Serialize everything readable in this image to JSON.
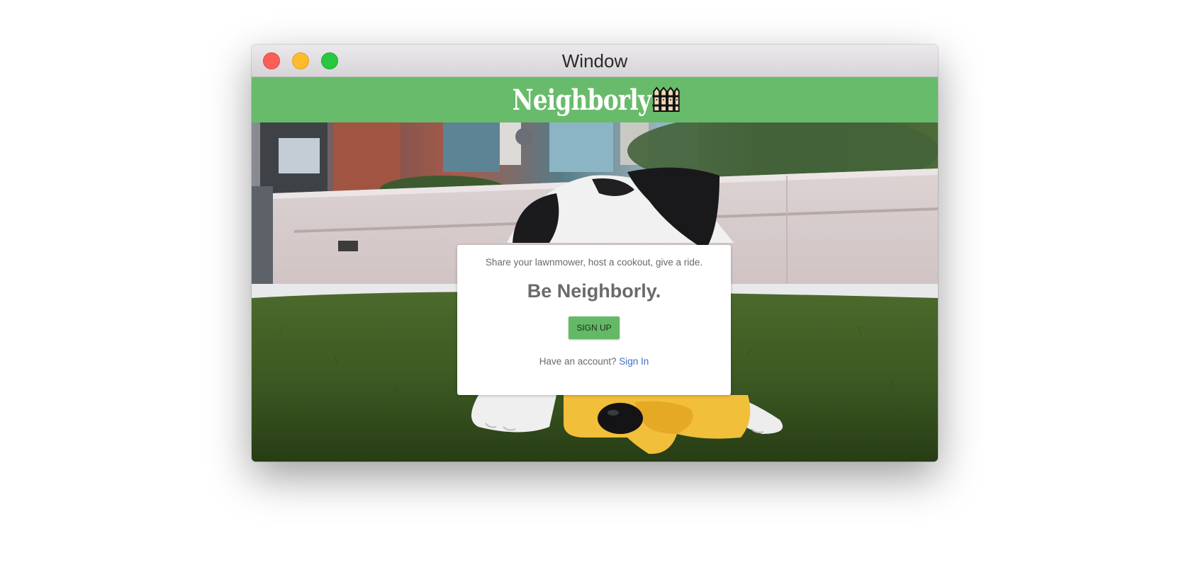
{
  "window": {
    "title": "Window"
  },
  "navbar": {
    "brand": "Neighborly",
    "brand_icon": "fence-icon"
  },
  "card": {
    "tagline": "Share your lawnmower, host a cookout, give a ride.",
    "headline": "Be Neighborly.",
    "signup_label": "SIGN UP",
    "account_prompt": "Have an account?",
    "signin_link": "Sign In"
  },
  "colors": {
    "navbar": "#68bb6a",
    "button": "#64b967",
    "link": "#3f6ec9"
  }
}
